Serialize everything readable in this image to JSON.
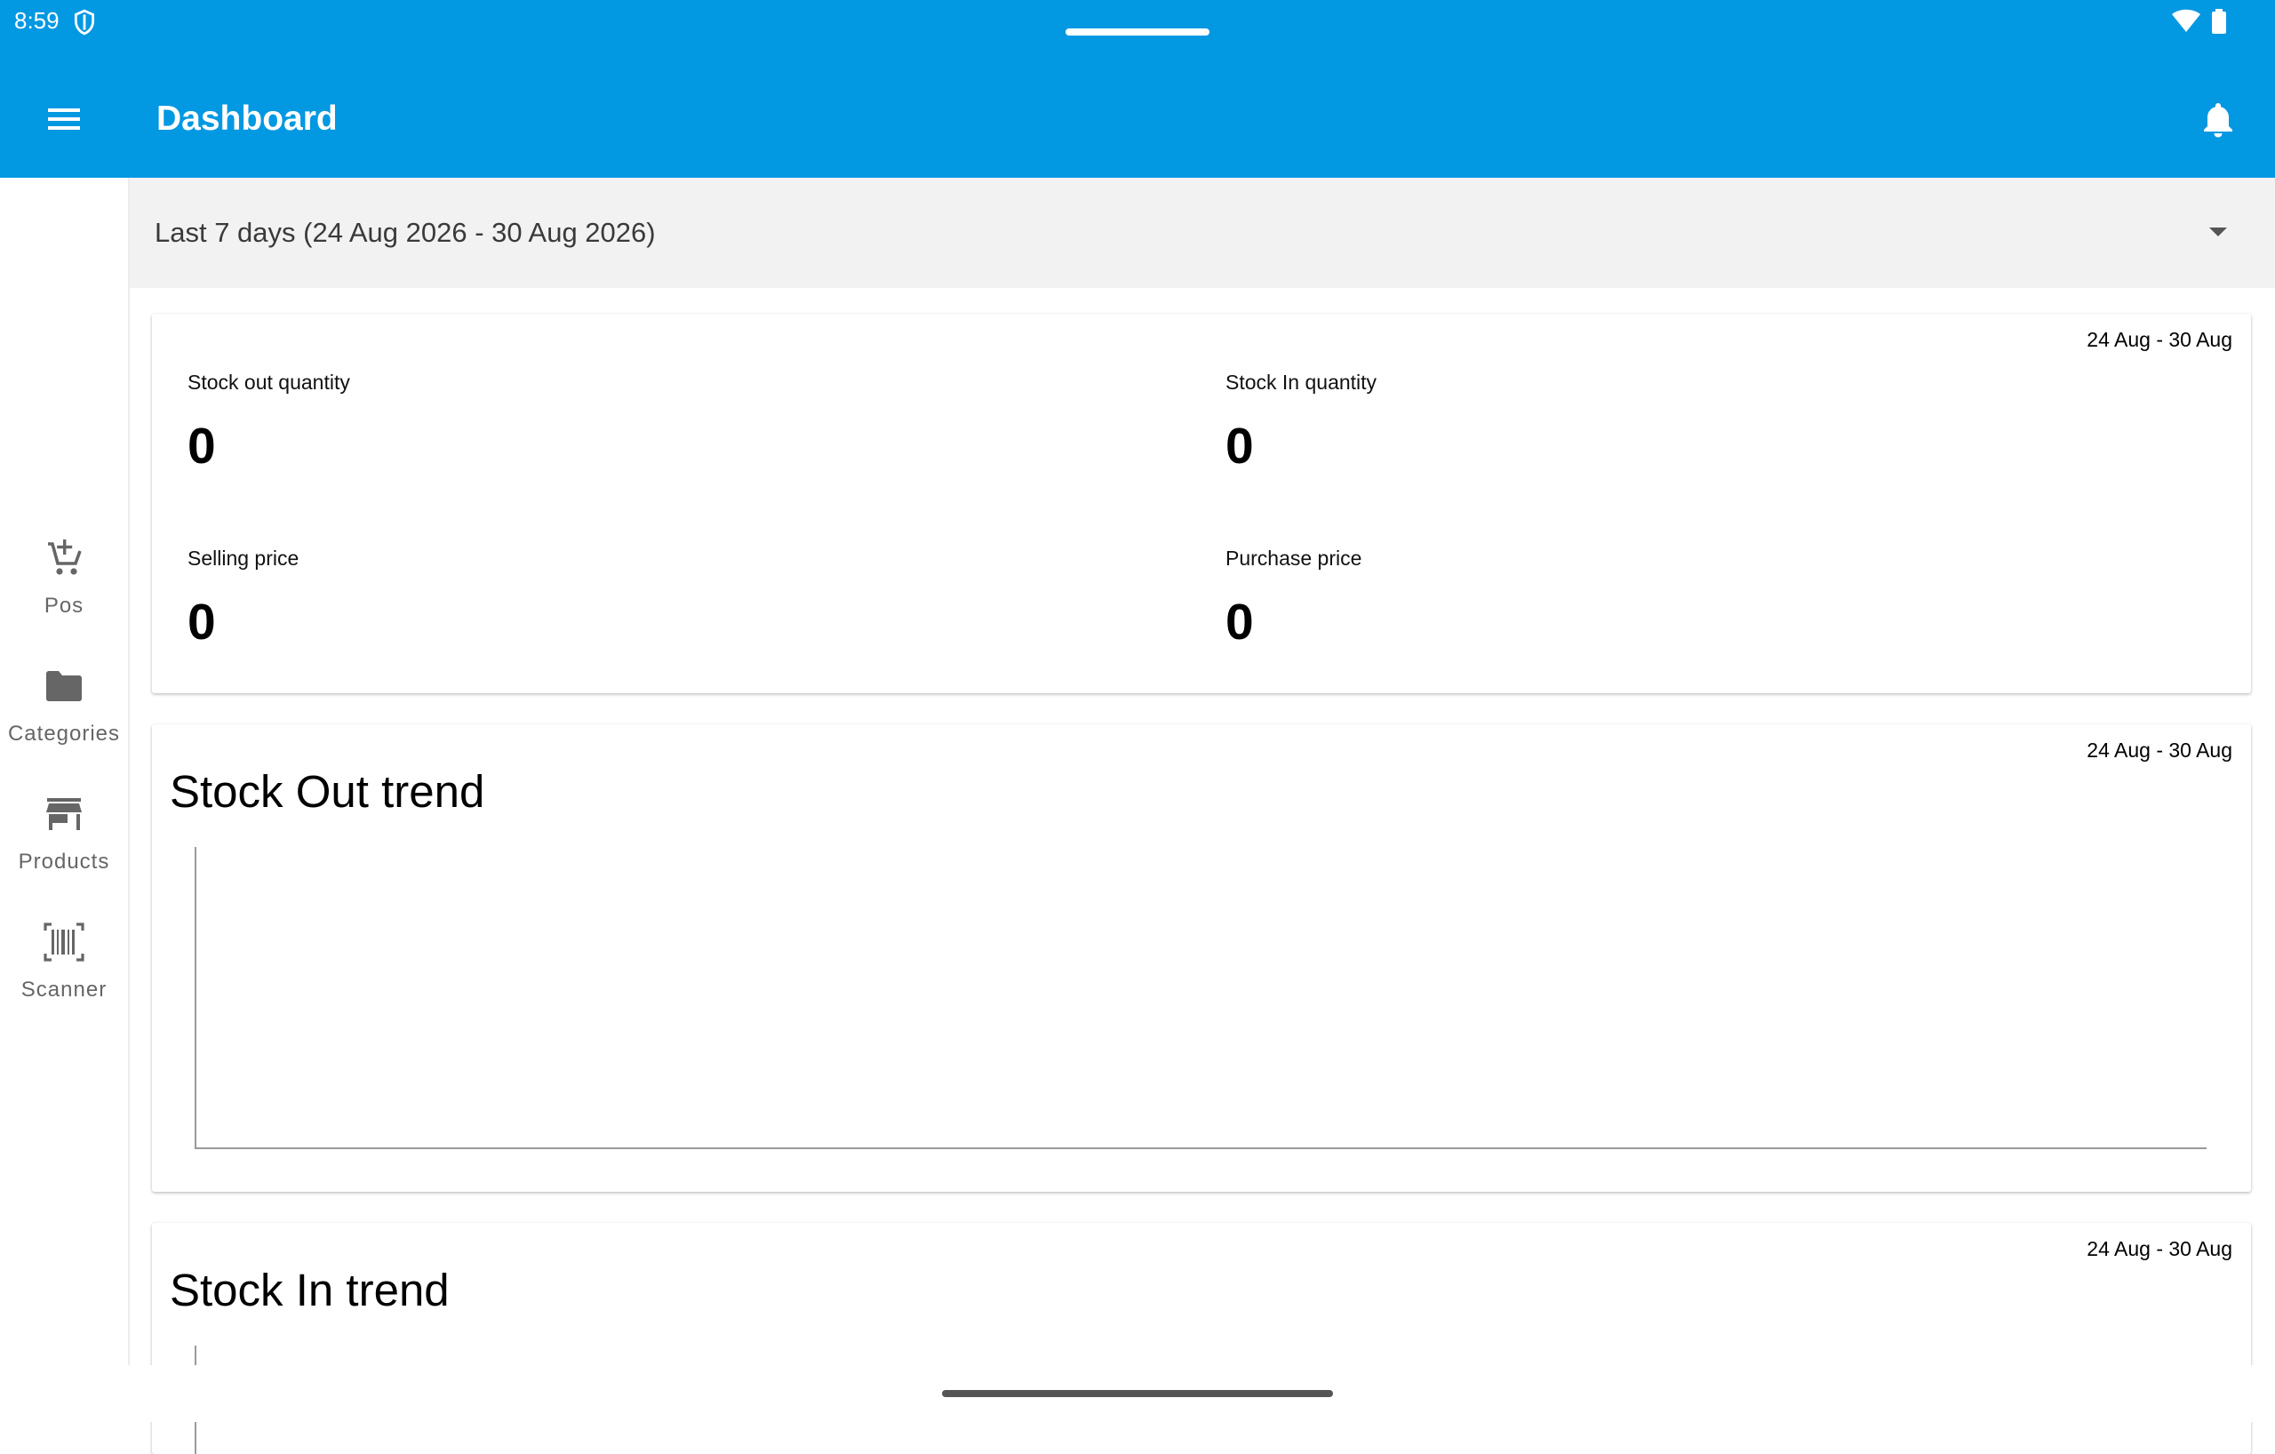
{
  "status_bar": {
    "time": "8:59"
  },
  "app_bar": {
    "title": "Dashboard"
  },
  "nav": {
    "items": [
      {
        "label": "Pos",
        "icon": "add-cart-icon"
      },
      {
        "label": "Categories",
        "icon": "folder-icon"
      },
      {
        "label": "Products",
        "icon": "store-icon"
      },
      {
        "label": "Scanner",
        "icon": "barcode-scanner-icon"
      }
    ]
  },
  "date_range": {
    "selected": "Last 7 days (24 Aug 2026 - 30 Aug 2026)"
  },
  "summary_card": {
    "range": "24 Aug - 30 Aug",
    "stats": [
      {
        "label": "Stock out quantity",
        "value": "0"
      },
      {
        "label": "Stock In quantity",
        "value": "0"
      },
      {
        "label": "Selling price",
        "value": "0"
      },
      {
        "label": "Purchase price",
        "value": "0"
      }
    ]
  },
  "stock_out_trend": {
    "title": "Stock Out trend",
    "range": "24 Aug - 30 Aug"
  },
  "stock_in_trend": {
    "title": "Stock In trend",
    "range": "24 Aug - 30 Aug"
  },
  "colors": {
    "primary": "#0398e2",
    "dropdown_bg": "#f2f2f2",
    "rail_label": "#666666"
  }
}
